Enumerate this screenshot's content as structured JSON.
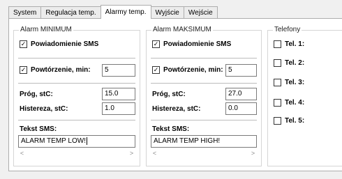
{
  "tabs": [
    {
      "label": "System",
      "active": false
    },
    {
      "label": "Regulacja temp.",
      "active": false
    },
    {
      "label": "Alarmy temp.",
      "active": true
    },
    {
      "label": "Wyjście",
      "active": false
    },
    {
      "label": "Wejście",
      "active": false
    }
  ],
  "alarm_min": {
    "title": "Alarm MINIMUM",
    "sms_notification": {
      "label": "Powiadomienie SMS",
      "checked": true
    },
    "repeat": {
      "label": "Powtórzenie, min:",
      "checked": true,
      "value": "5"
    },
    "threshold": {
      "label": "Próg, stC:",
      "value": "15.0"
    },
    "hysteresis": {
      "label": "Histereza, stC:",
      "value": "1.0"
    },
    "sms_text": {
      "label": "Tekst SMS:",
      "value": "ALARM TEMP LOW!"
    }
  },
  "alarm_max": {
    "title": "Alarm MAKSIMUM",
    "sms_notification": {
      "label": "Powiadomienie SMS",
      "checked": true
    },
    "repeat": {
      "label": "Powtórzenie, min:",
      "checked": true,
      "value": "5"
    },
    "threshold": {
      "label": "Próg, stC:",
      "value": "27.0"
    },
    "hysteresis": {
      "label": "Histereza, stC:",
      "value": "0.0"
    },
    "sms_text": {
      "label": "Tekst SMS:",
      "value": "ALARM TEMP HIGH!"
    }
  },
  "phones": {
    "title": "Telefony",
    "items": [
      {
        "label": "Tel. 1:",
        "checked": false
      },
      {
        "label": "Tel. 2:",
        "checked": false
      },
      {
        "label": "Tel. 3:",
        "checked": false
      },
      {
        "label": "Tel. 4:",
        "checked": false
      },
      {
        "label": "Tel. 5:",
        "checked": false
      }
    ]
  },
  "scroll_arrows": {
    "left": "<",
    "right": ">"
  },
  "check_mark": "✓"
}
